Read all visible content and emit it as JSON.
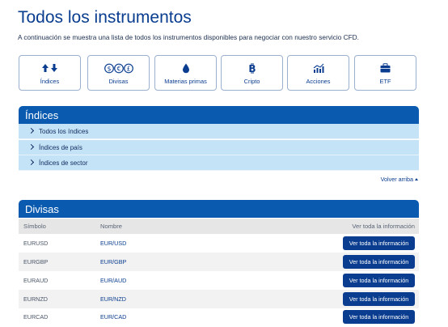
{
  "header": {
    "title": "Todos los instrumentos",
    "intro": "A continuación se muestra una lista de todos los instrumentos disponibles para negociar con nuestro servicio CFD."
  },
  "categories": [
    {
      "label": "Índices",
      "icon": "up-down-arrows-icon"
    },
    {
      "label": "Divisas",
      "icon": "currency-coins-icon"
    },
    {
      "label": "Materias primas",
      "icon": "drop-icon"
    },
    {
      "label": "Cripto",
      "icon": "bitcoin-icon"
    },
    {
      "label": "Acciones",
      "icon": "growth-chart-icon"
    },
    {
      "label": "ETF",
      "icon": "briefcase-icon"
    }
  ],
  "indices": {
    "title": "Índices",
    "items": [
      "Todos los índices",
      "Índices de país",
      "Índices de sector"
    ]
  },
  "back_to_top": "Volver arriba",
  "divisas": {
    "title": "Divisas",
    "columns": {
      "symbol": "Símbolo",
      "name": "Nombre",
      "info": "Ver toda la información"
    },
    "rows": [
      {
        "symbol": "EURUSD",
        "name": "EUR/USD",
        "button": "Ver toda la información"
      },
      {
        "symbol": "EURGBP",
        "name": "EUR/GBP",
        "button": "Ver toda la información"
      },
      {
        "symbol": "EURAUD",
        "name": "EUR/AUD",
        "button": "Ver toda la información"
      },
      {
        "symbol": "EURNZD",
        "name": "EUR/NZD",
        "button": "Ver toda la información"
      },
      {
        "symbol": "EURCAD",
        "name": "EUR/CAD",
        "button": "Ver toda la información"
      }
    ]
  },
  "colors": {
    "brand": "#0a3d8f",
    "panel_header": "#0a5bb0",
    "accordion_bg": "#c5e3f7"
  }
}
